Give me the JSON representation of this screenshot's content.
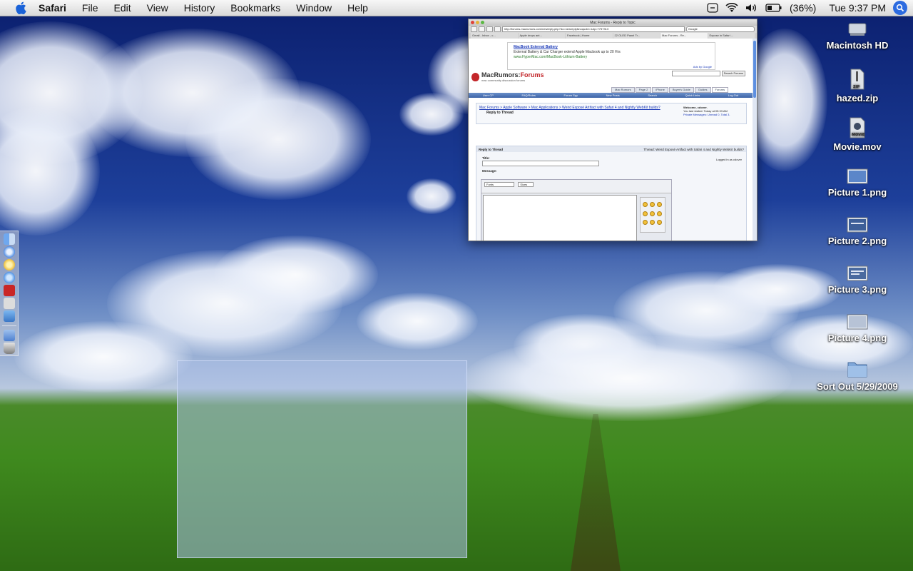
{
  "menubar": {
    "app_name": "Safari",
    "items": [
      "File",
      "Edit",
      "View",
      "History",
      "Bookmarks",
      "Window",
      "Help"
    ],
    "battery": "(36%)",
    "clock": "Tue 9:37 PM"
  },
  "browser": {
    "window_title": "Mac Forums - Reply to Topic",
    "url": "http://forums.macrumors.com/newreply.php?do=newreply&noquote=1&p=7757313",
    "search_placeholder": "Google",
    "tabs": [
      "Gmail - Inbox - c...",
      "Apple drops ant...",
      "Facebook | Home",
      "22 OLED Panel Tr...",
      "Mac Forums - Re...",
      "Expose in Safari ..."
    ],
    "ad": {
      "title": "MacBook External Battery",
      "body": "External Battery & Car Charger extend Apple Macbook up to 20 Hrs",
      "url": "www.HyperMac.com/MacBook-Lithium-Battery",
      "by": "Ads by Google"
    },
    "logo_name": "MacRumors:",
    "logo_accent": "Forums",
    "logo_tagline": "mac community discussion forums",
    "search_button": "Search Forums",
    "nav_tabs": [
      "Mac Rumors",
      "Page 2",
      "iPhone",
      "Buyer's Guide",
      "Guides",
      "Forums"
    ],
    "nav_bar": [
      "User CP",
      "FAQ/Rules",
      "Forum Spy",
      "New Posts",
      "Search",
      "Quick Links",
      "Log Out"
    ],
    "breadcrumb": "Mac Forums > Apple Software > Mac Applications > Weird Exposé Artifact with Safari 4 and Nightly WebKit builds?",
    "page_heading": "Reply to Thread",
    "welcome": "Welcome, cdover.",
    "last_visit": "You last visited: Today at 05:33 AM",
    "private_messages": "Private Messages: Unread 0, Total 3.",
    "reply_label": "Reply to Thread",
    "thread_label": "Thread: Weird Exposé Artifact with Safari 4 and Nightly WebKit builds?",
    "title_label": "Title:",
    "message_label": "Message:",
    "logged_in": "Logged in as cdover",
    "font_select": "Fonts",
    "size_select": "Sizes",
    "smilies_label": "Smilies"
  },
  "desktop_icons": [
    {
      "label": "Macintosh HD",
      "icon": "hard-drive-icon"
    },
    {
      "label": "hazed.zip",
      "icon": "zip-file-icon"
    },
    {
      "label": "Movie.mov",
      "icon": "movie-file-icon"
    },
    {
      "label": "Picture 1.png",
      "icon": "image-file-icon"
    },
    {
      "label": "Picture 2.png",
      "icon": "image-file-icon"
    },
    {
      "label": "Picture 3.png",
      "icon": "image-file-icon"
    },
    {
      "label": "Picture 4.png",
      "icon": "image-file-icon"
    },
    {
      "label": "Sort Out 5/29/2009",
      "icon": "folder-icon"
    }
  ],
  "dock_apps": [
    "finder-icon",
    "safari-icon",
    "ical-icon",
    "itunes-icon",
    "textedit-icon",
    "preview-icon",
    "iphoto-icon",
    "applications-icon",
    "trash-icon"
  ],
  "colors": {
    "accent": "#2c6be0",
    "forum_red": "#c3262a",
    "selection": "#aabee6"
  }
}
